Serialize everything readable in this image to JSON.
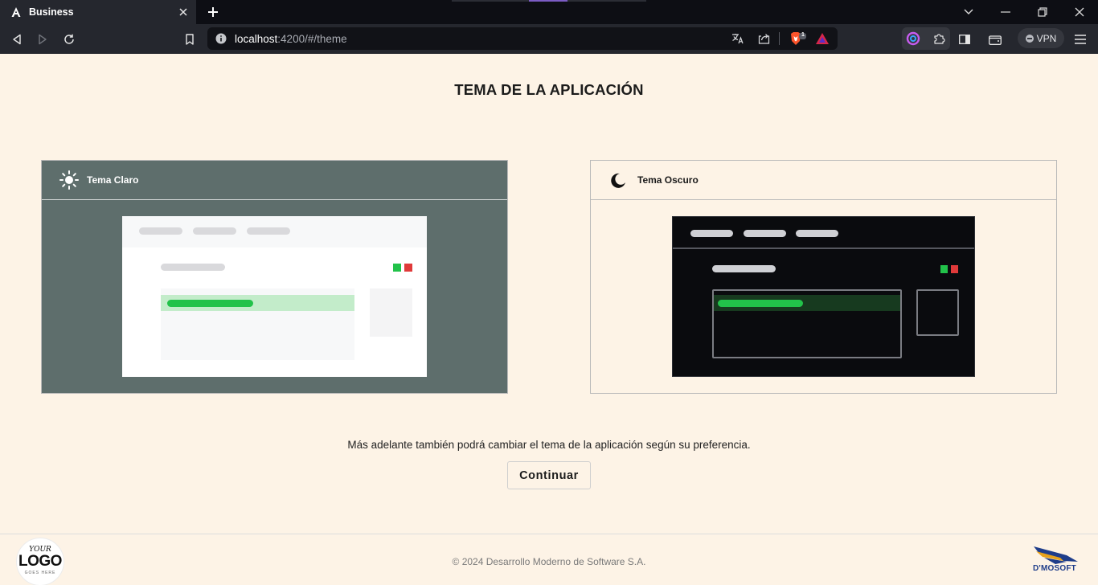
{
  "browser": {
    "tab_title": "Business",
    "url_host": "localhost",
    "url_path": ":4200/#/theme",
    "vpn_label": "VPN",
    "brave_badge": "1"
  },
  "page": {
    "title": "TEMA DE LA APLICACIÓN",
    "themes": {
      "light_label": "Tema Claro",
      "dark_label": "Tema Oscuro"
    },
    "info_text": "Más adelante también podrá cambiar el tema de la aplicación según su preferencia.",
    "continue_label": "Continuar"
  },
  "footer": {
    "logo_top": "YOUR",
    "logo_main": "LOGO",
    "logo_sub": "GOES HERE",
    "copyright": "© 2024 Desarrollo Moderno de Software S.A.",
    "brand": "D'MOSOFT"
  },
  "colors": {
    "page_background": "#fdf3e6",
    "light_card_background": "#5e6e6c",
    "dark_preview_background": "#0a0b0e",
    "success_green": "#22c24a",
    "danger_red": "#e03a3a"
  },
  "icons": {
    "light_theme": "sun-icon",
    "dark_theme": "moon-icon"
  }
}
